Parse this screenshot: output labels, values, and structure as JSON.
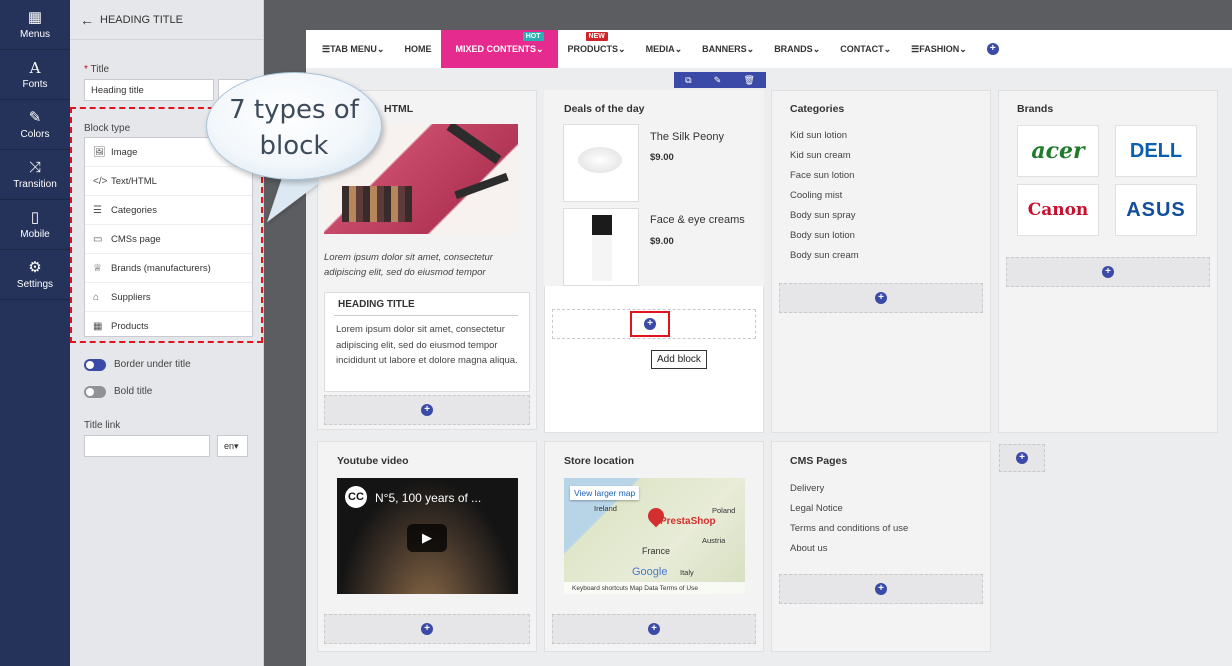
{
  "sidebar": {
    "items": [
      {
        "label": "Menus",
        "icon": "grid-icon"
      },
      {
        "label": "Fonts",
        "icon": "font-icon"
      },
      {
        "label": "Colors",
        "icon": "brush-icon"
      },
      {
        "label": "Transition",
        "icon": "shuffle-icon"
      },
      {
        "label": "Mobile",
        "icon": "mobile-icon"
      },
      {
        "label": "Settings",
        "icon": "gear-icon"
      }
    ]
  },
  "panel": {
    "header": "HEADING TITLE",
    "title_label": "Title",
    "title_value": "Heading title",
    "block_type_label": "Block type",
    "block_types": [
      "Image",
      "Text/HTML",
      "Categories",
      "CMSs page",
      "Brands (manufacturers)",
      "Suppliers",
      "Products"
    ],
    "border_under_title": "Border under title",
    "bold_title": "Bold title",
    "title_link_label": "Title link",
    "lang": "en"
  },
  "callout": {
    "line1": "7 types of",
    "line2": "block"
  },
  "menu": {
    "items": [
      "TAB MENU",
      "HOME",
      "MIXED CONTENTS",
      "PRODUCTS",
      "MEDIA",
      "BANNERS",
      "BRANDS",
      "CONTACT",
      "FASHION"
    ],
    "badge_hot": "HOT",
    "badge_new": "NEW"
  },
  "columns": {
    "html_title": "HTML",
    "lorem_italic": "Lorem ipsum dolor sit amet, consectetur adipiscing elit, sed do eiusmod tempor",
    "heading_box_title": "HEADING TITLE",
    "heading_box_text": "Lorem ipsum dolor sit amet, consectetur adipiscing elit, sed do eiusmod tempor incididunt ut labore et dolore magna aliqua.",
    "deals_title": "Deals of the day",
    "product1_name": "The Silk Peony",
    "product1_price": "$9.00",
    "product2_name": "Face & eye creams",
    "product2_price": "$9.00",
    "add_block_tooltip": "Add block",
    "categories_title": "Categories",
    "categories": [
      "Kid sun lotion",
      "Kid sun cream",
      "Face sun lotion",
      "Cooling mist",
      "Body sun spray",
      "Body sun lotion",
      "Body sun cream"
    ],
    "brands_title": "Brands",
    "brands": [
      "acer",
      "DELL",
      "Canon",
      "ASUS"
    ],
    "youtube_title": "Youtube video",
    "video_title": "N°5, 100 years of ...",
    "store_title": "Store location",
    "map_link": "View larger map",
    "map_labels": [
      "Ireland",
      "Poland",
      "PrestaShop",
      "Austria",
      "France",
      "Italy",
      "Google"
    ],
    "map_footer": "Keyboard shortcuts   Map Data   Terms of Use",
    "cms_title": "CMS Pages",
    "cms_pages": [
      "Delivery",
      "Legal Notice",
      "Terms and conditions of use",
      "About us"
    ]
  },
  "colors": {
    "accent": "#e62b8f",
    "sidebar": "#25335a",
    "plus": "#3b4aa6",
    "dashed": "#e1131c"
  }
}
